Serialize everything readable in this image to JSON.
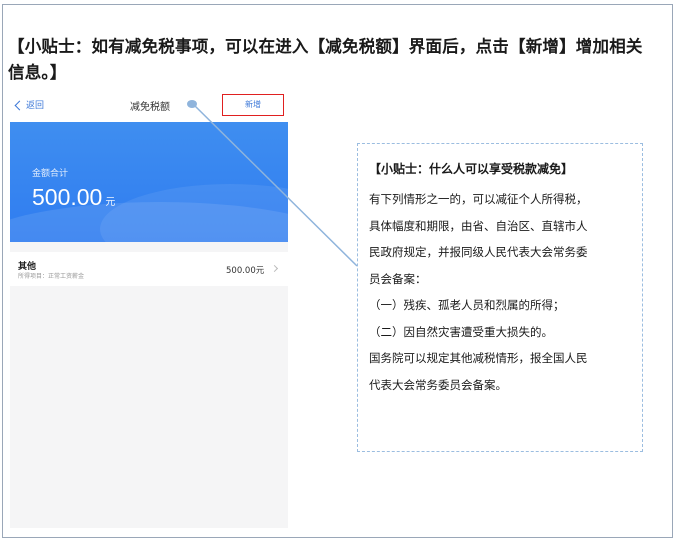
{
  "tip_heading": "【小贴士：如有减免税事项，可以在进入【减免税额】界面后，点击【新增】增加相关信息。】",
  "phone": {
    "nav": {
      "back_label": "返回",
      "title": "减免税额",
      "add_label": "新增"
    },
    "summary": {
      "label": "金额合计",
      "value": "500.00",
      "unit": "元"
    },
    "items": [
      {
        "name": "其他",
        "subtitle": "所得项目：正常工资薪金",
        "amount": "500.00元"
      }
    ]
  },
  "callout": {
    "title": "【小贴士：什么人可以享受税款减免】",
    "lines": [
      "有下列情形之一的，可以减征个人所得税，",
      "具体幅度和期限，由省、自治区、直辖市人",
      "民政府规定，并报同级人民代表大会常务委",
      "员会备案：",
      "（一）残疾、孤老人员和烈属的所得；",
      "（二）因自然灾害遭受重大损失的。",
      "国务院可以规定其他减税情形，报全国人民",
      "代表大会常务委员会备案。"
    ]
  },
  "colors": {
    "accent_blue": "#3c78d8",
    "banner_blue": "#3486f0",
    "highlight_red": "#e02020",
    "callout_border": "#9bbde0",
    "connector_line": "#8fb4dc"
  }
}
